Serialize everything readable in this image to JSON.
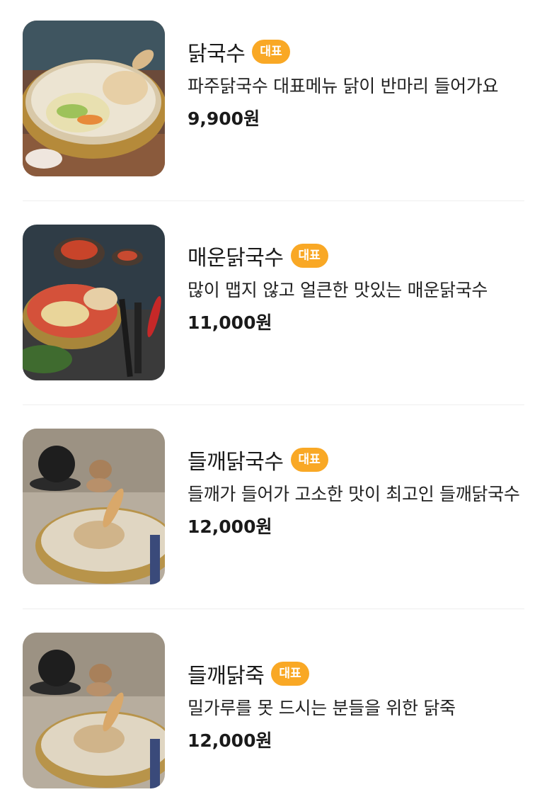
{
  "theme": {
    "badge_color": "#F9A825",
    "divider_color": "#EEEEEE"
  },
  "menu": {
    "items": [
      {
        "name": "닭국수",
        "badge": "대표",
        "description": "파주닭국수 대표메뉴 닭이 반마리 들어가요",
        "price": "9,900원",
        "image": "chicken-noodle-soup-photo"
      },
      {
        "name": "매운닭국수",
        "badge": "대표",
        "description": "많이 맵지 않고 얼큰한 맛있는 매운닭국수",
        "price": "11,000원",
        "image": "spicy-chicken-noodle-photo"
      },
      {
        "name": "들깨닭국수",
        "badge": "대표",
        "description": "들깨가 들어가 고소한 맛이 최고인 들깨닭국수",
        "price": "12,000원",
        "image": "perilla-chicken-noodle-photo"
      },
      {
        "name": "들깨닭죽",
        "badge": "대표",
        "description": "밀가루를 못 드시는 분들을 위한 닭죽",
        "price": "12,000원",
        "image": "perilla-chicken-porridge-photo"
      }
    ]
  }
}
